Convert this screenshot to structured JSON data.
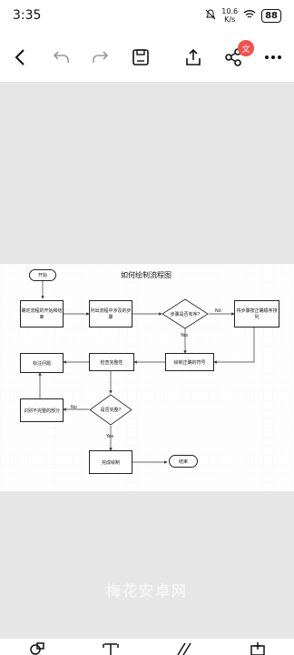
{
  "status_bar": {
    "time": "3:35",
    "net_speed_value": "10.6",
    "net_speed_unit": "K/s",
    "battery": "88"
  },
  "toolbar": {
    "badge": "文"
  },
  "flowchart": {
    "title": "如何绘制流程图",
    "start": "开始",
    "step1": "确定流程的开始和结束",
    "step2": "列出流程中涉及的步骤",
    "decision1": "步骤是否有序?",
    "no1": "No",
    "step3": "将步骤按正确顺序排列",
    "yes1": "Yes",
    "step4": "绘制正确的符号",
    "step5": "检查完整性",
    "step6": "标注问题",
    "decision2": "是否完整?",
    "no2": "No",
    "step7": "识别不完整的部分",
    "yes2": "Yes",
    "step8": "完成绘制",
    "end": "结束"
  },
  "watermark": "梅花安卓网",
  "colors": {
    "gray_panel": "#e6e6e6",
    "badge": "#ef5350"
  }
}
